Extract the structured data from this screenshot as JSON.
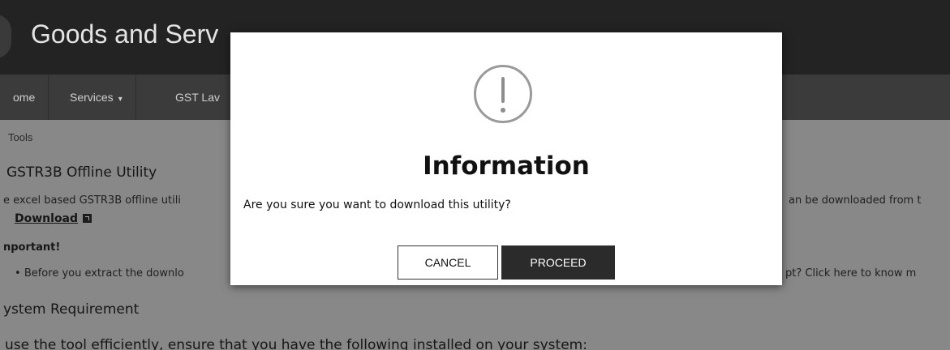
{
  "header": {
    "title": "Goods and Serv"
  },
  "nav": {
    "items": [
      {
        "label": "ome"
      },
      {
        "label": "Services"
      },
      {
        "label": "GST Lav"
      }
    ]
  },
  "breadcrumb": {
    "label": "Tools"
  },
  "content": {
    "heading": "GSTR3B Offline Utility",
    "intro_left": "e excel based GSTR3B offline utili",
    "intro_right": "an be downloaded from t",
    "download_label": "Download",
    "important_title": "nportant!",
    "bullet_left": "Before you extract the downlo",
    "bullet_right": "pt? Click here to know m",
    "sysreq_heading": "ystem Requirement",
    "bottom_text": "use the tool efficiently, ensure that you have the following installed on your system:"
  },
  "modal": {
    "icon": "exclamation-circle-icon",
    "title": "Information",
    "message": "Are you sure you want to download this utility?",
    "cancel_label": "CANCEL",
    "proceed_label": "PROCEED"
  }
}
